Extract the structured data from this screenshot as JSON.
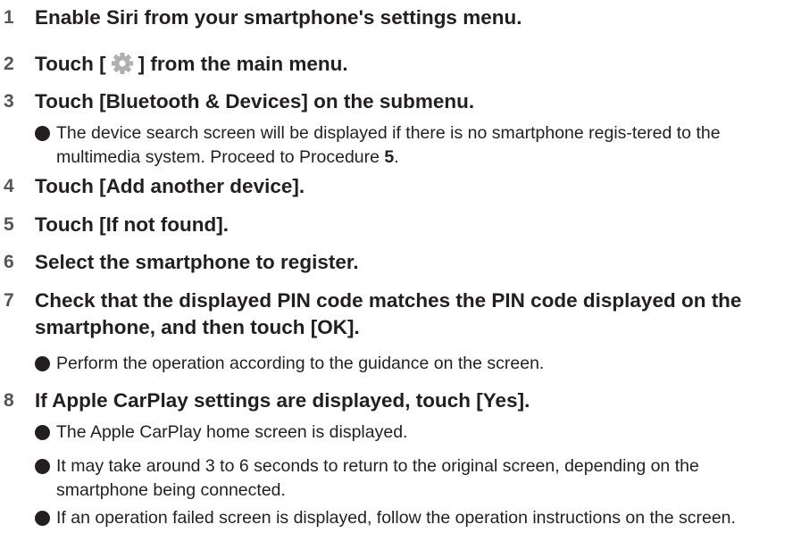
{
  "steps": [
    {
      "num": "1",
      "text": "Enable Siri from your smartphone's settings menu."
    },
    {
      "num": "2",
      "text_before": "Touch [",
      "icon": "settings-gear-icon",
      "text_after": "] from the main menu."
    },
    {
      "num": "3",
      "text": "Touch [Bluetooth & Devices] on the submenu.",
      "notes": [
        {
          "text": "The device search screen will be displayed if there is no smartphone regis-tered to the multimedia system. Proceed to Procedure ",
          "ref": "5",
          "text_end": "."
        }
      ]
    },
    {
      "num": "4",
      "text": "Touch [Add another device]."
    },
    {
      "num": "5",
      "text": "Touch [If not found]."
    },
    {
      "num": "6",
      "text": "Select the smartphone to register."
    },
    {
      "num": "7",
      "text": "Check that the displayed PIN code matches the PIN code displayed on the smartphone, and then touch [OK].",
      "notes": [
        {
          "text": "Perform the operation according to the guidance on the screen."
        }
      ]
    },
    {
      "num": "8",
      "text": "If Apple CarPlay settings are displayed, touch [Yes].",
      "notes": [
        {
          "text": "The Apple CarPlay home screen is displayed."
        },
        {
          "text": "It may take around 3 to 6 seconds to return to the original screen, depending on the smartphone being connected."
        },
        {
          "text": "If an operation failed screen is displayed, follow the operation instructions on the screen."
        }
      ]
    }
  ],
  "colors": {
    "text": "#231f20",
    "step_number": "#555555",
    "icon_gray": "#b0b0b0"
  }
}
